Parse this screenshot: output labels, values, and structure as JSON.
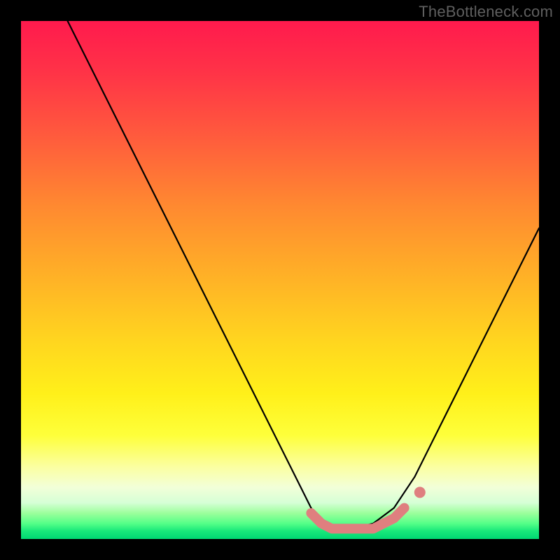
{
  "watermark": "TheBottleneck.com",
  "chart_data": {
    "type": "line",
    "title": "",
    "xlabel": "",
    "ylabel": "",
    "xlim": [
      0,
      100
    ],
    "ylim": [
      0,
      100
    ],
    "grid": false,
    "legend": false,
    "series": [
      {
        "name": "black-curve",
        "color": "#000000",
        "x": [
          9,
          15,
          22,
          30,
          38,
          46,
          52,
          56,
          58,
          60,
          64,
          68,
          72,
          76,
          80,
          86,
          92,
          98,
          100
        ],
        "y": [
          100,
          88,
          74,
          58,
          42,
          26,
          14,
          6,
          3,
          2,
          2,
          3,
          6,
          12,
          20,
          32,
          44,
          56,
          60
        ]
      },
      {
        "name": "pink-band",
        "color": "#e08080",
        "x": [
          56,
          58,
          60,
          62,
          64,
          66,
          68,
          70,
          72,
          74
        ],
        "y": [
          5,
          3,
          2,
          2,
          2,
          2,
          2,
          3,
          4,
          6
        ]
      },
      {
        "name": "pink-dot",
        "color": "#e08080",
        "x": [
          77
        ],
        "y": [
          9
        ]
      }
    ],
    "gradient_stops": [
      {
        "pos": 0,
        "color": "#ff1a4d"
      },
      {
        "pos": 50,
        "color": "#ffb326"
      },
      {
        "pos": 80,
        "color": "#feff3a"
      },
      {
        "pos": 93,
        "color": "#d6ffd6"
      },
      {
        "pos": 100,
        "color": "#00d873"
      }
    ]
  }
}
